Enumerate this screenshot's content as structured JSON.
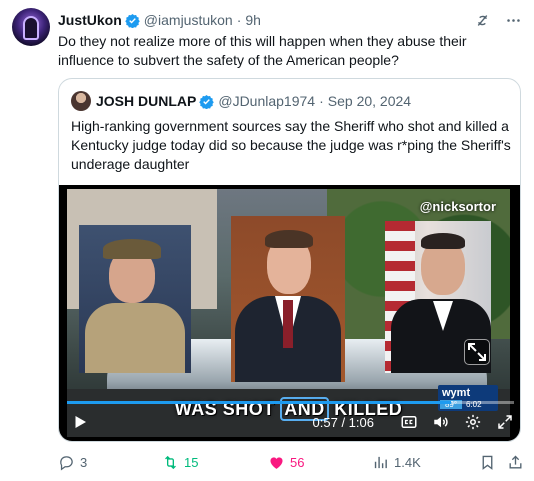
{
  "post": {
    "display_name": "JustUkon",
    "handle": "@iamjustukon",
    "separator": "·",
    "time": "9h",
    "text": "Do they not realize more of this will happen when they abuse their influence to subvert the safety of the American people?"
  },
  "quote": {
    "display_name": "JOSH DUNLAP",
    "handle": "@JDunlap1974",
    "separator": "·",
    "date": "Sep 20, 2024",
    "text": "High-ranking government sources say the Sheriff who shot and killed a Kentucky judge today did so because the judge was r*ping the Sheriff's underage daughter"
  },
  "video": {
    "watermark": "@nicksortor",
    "caption_before": "WAS SHOT ",
    "caption_highlight": "AND",
    "caption_after": " KILLED",
    "station_brand": "wymt",
    "station_temp": "89°",
    "station_clock": "6:02",
    "time_display": "0:57 / 1:06",
    "progress": 0.86
  },
  "actions": {
    "replies": "3",
    "reposts": "15",
    "likes": "56",
    "views": "1.4K"
  },
  "icons": [
    "verified-badge-icon",
    "grok-icon",
    "more-icon",
    "play-icon",
    "captions-icon",
    "volume-icon",
    "settings-icon",
    "fullscreen-icon",
    "expand-icon",
    "reply-icon",
    "repost-icon",
    "like-icon",
    "views-icon",
    "bookmark-icon",
    "share-icon"
  ],
  "colors": {
    "accent": "#1d9bf0",
    "repost": "#00ba7c",
    "like": "#f91880",
    "muted": "#536471"
  }
}
